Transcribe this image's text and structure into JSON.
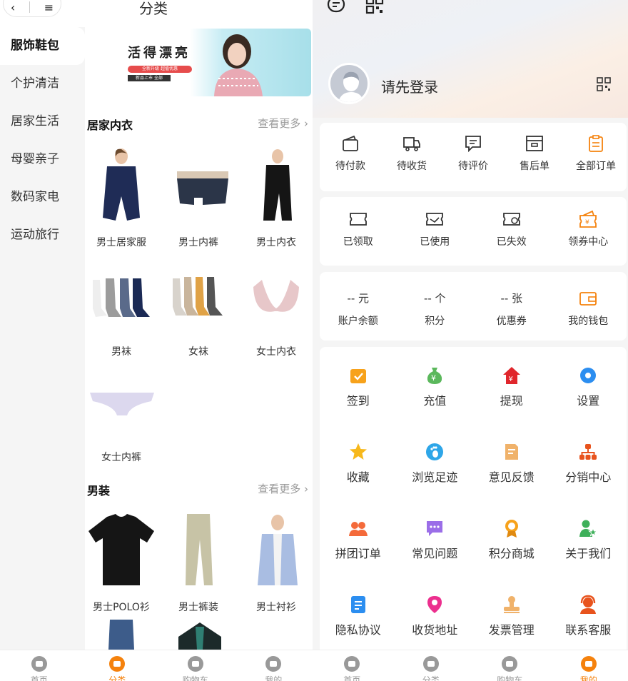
{
  "left": {
    "title": "分类",
    "categories": [
      "服饰鞋包",
      "个护清洁",
      "居家生活",
      "母婴亲子",
      "数码家电",
      "运动旅行"
    ],
    "banner_text": "活得漂亮",
    "banner_tag1": "全新升级 超值优惠",
    "banner_tag2": "新品上市 全部",
    "sections": [
      {
        "title": "居家内衣",
        "more": "查看更多",
        "items": [
          "男士居家服",
          "男士内裤",
          "男士内衣",
          "男袜",
          "女袜",
          "女士内衣",
          "女士内裤"
        ]
      },
      {
        "title": "男装",
        "more": "查看更多",
        "items": [
          "男士POLO衫",
          "男士裤装",
          "男士衬衫"
        ]
      }
    ],
    "tabbar": [
      "首页",
      "分类",
      "购物车",
      "我的"
    ]
  },
  "right": {
    "login": "请先登录",
    "orders": [
      "待付款",
      "待收货",
      "待评价",
      "售后单",
      "全部订单"
    ],
    "coupons": [
      "已领取",
      "已使用",
      "已失效",
      "领券中心"
    ],
    "wallet_values": [
      "-- 元",
      "-- 个",
      "-- 张"
    ],
    "wallet_labels": [
      "账户余额",
      "积分",
      "优惠券",
      "我的钱包"
    ],
    "services": [
      "签到",
      "充值",
      "提现",
      "设置",
      "收藏",
      "浏览足迹",
      "意见反馈",
      "分销中心",
      "拼团订单",
      "常见问题",
      "积分商城",
      "关于我们",
      "隐私协议",
      "收货地址",
      "发票管理",
      "联系客服"
    ],
    "tabbar": [
      "首页",
      "分类",
      "购物车",
      "我的"
    ]
  },
  "colors": {
    "accent": "#f5820d",
    "bg": "#f5f5f5"
  }
}
